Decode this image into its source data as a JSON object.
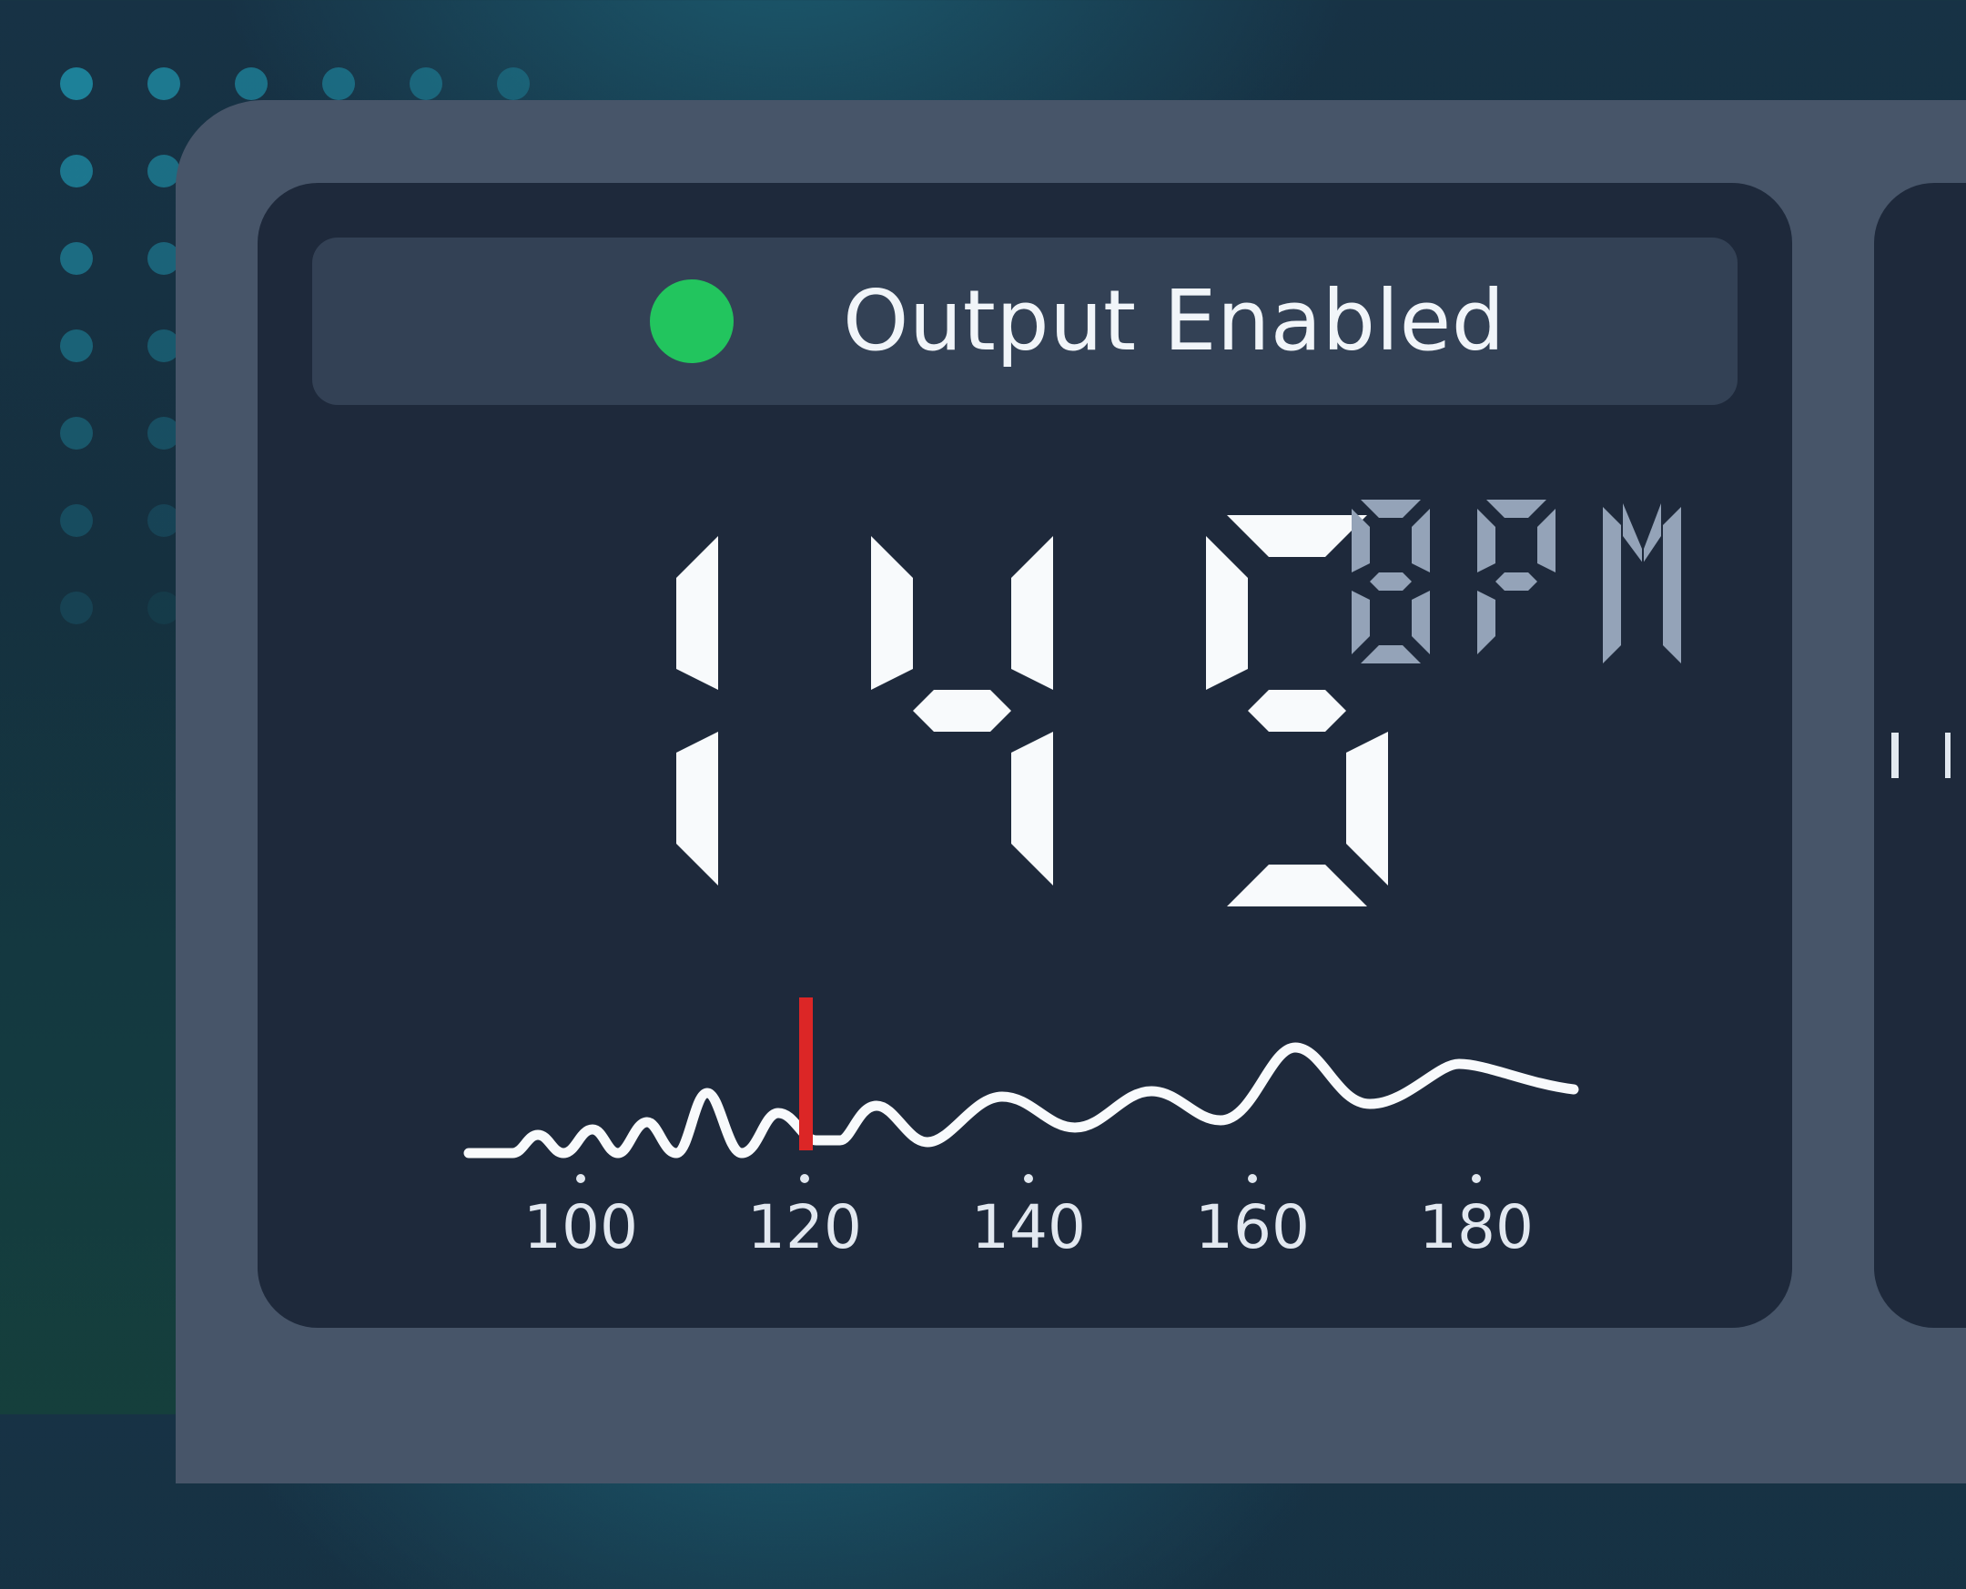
{
  "status": {
    "label": "Output Enabled",
    "indicator_color": "#22c55e",
    "indicator_icon": "status-dot-icon"
  },
  "reading": {
    "value": "145",
    "unit": "BPM"
  },
  "scale": {
    "ticks": [
      "100",
      "120",
      "140",
      "160",
      "180"
    ],
    "marker_value": 120,
    "marker_color": "#dc2626"
  },
  "colors": {
    "background": "#173245",
    "device": "#475569",
    "panel": "#1e293b",
    "status_bar": "#334155",
    "digits": "#f8fafc",
    "unit_digits": "#94a3b8"
  }
}
